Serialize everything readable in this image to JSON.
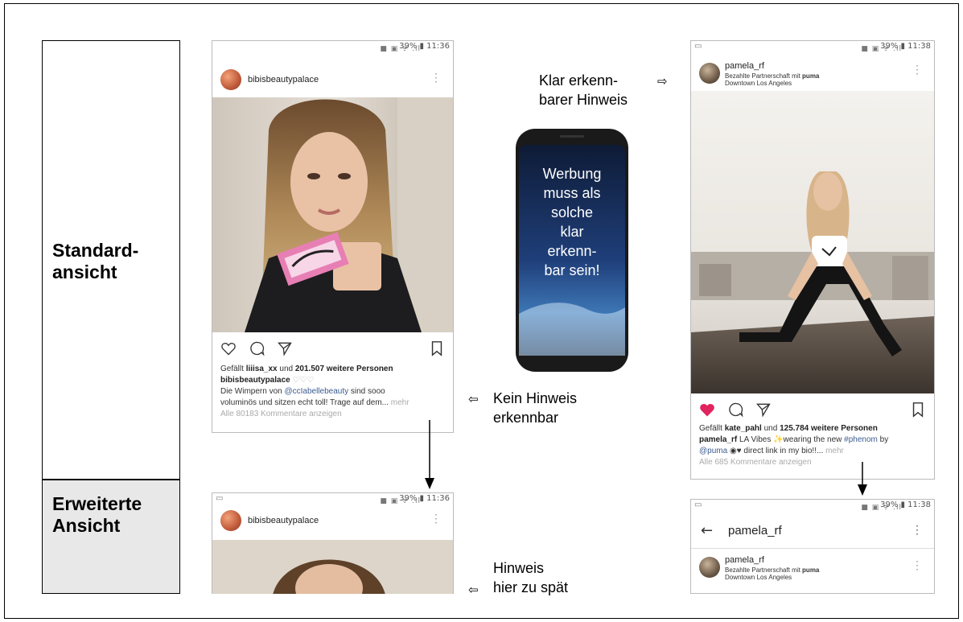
{
  "labels": {
    "standard": "Standard-\nansicht",
    "extended": "Erweiterte\nAnsicht"
  },
  "notes": {
    "no_hint": "Kein Hinweis\nerkennbar",
    "clear_hint": "Klar erkenn-\nbarer Hinweis",
    "late_hint": "Hinweis\nhier zu spät",
    "phone_text": "Werbung\nmuss als\nsolche\nklar\nerkenn-\nbar sein!"
  },
  "arrow_glyph": "⇦",
  "arrow_glyph_right": "⇨",
  "post_left": {
    "status_time": "39% ▮ 11:36",
    "username": "bibisbeautypalace",
    "likes_prefix": "Gefällt ",
    "likes_user": "liiisa_xx",
    "likes_mid": " und ",
    "likes_count": "201.507 weitere Personen",
    "caption_user": "bibisbeautypalace",
    "caption_hearts": " ♡♡♡",
    "caption_line1_pre": "Die Wimpern von ",
    "caption_mention": "@ccIabellebeauty",
    "caption_line1_post": " sind sooo",
    "caption_line2": "voluminös und sitzen echt toll! Trage auf dem...",
    "more": " mehr",
    "comments": "Alle 80183 Kommentare anzeigen"
  },
  "post_left_extended": {
    "status_time": "39% ▮ 11:36",
    "username": "bibisbeautypalace"
  },
  "post_right": {
    "status_time": "39% ▮ 11:38",
    "username": "pamela_rf",
    "partner_prefix": "Bezahlte Partnerschaft mit ",
    "partner_brand": "puma",
    "location": "Downtown Los Angeles",
    "likes_prefix": "Gefällt ",
    "likes_user": "kate_pahl",
    "likes_mid": " und ",
    "likes_count": "125.784 weitere Personen",
    "caption_user": "pamela_rf",
    "caption_text1": " LA Vibes ✨wearing the new ",
    "caption_tag": "#phenom",
    "caption_text1b": " by",
    "caption_mention": "@puma",
    "caption_text2": " ◉♥ direct link in my bio!!...",
    "more": " mehr",
    "comments": "Alle 685 Kommentare anzeigen"
  },
  "post_right_extended": {
    "status_time": "39% ▮ 11:38",
    "back_title": "pamela_rf",
    "username": "pamela_rf",
    "partner_prefix": "Bezahlte Partnerschaft mit ",
    "partner_brand": "puma",
    "location": "Downtown Los Angeles"
  },
  "colors": {
    "heart_red": "#e0245e",
    "link_blue": "#3b5c8f",
    "label_gray": "#e8e8e8"
  }
}
